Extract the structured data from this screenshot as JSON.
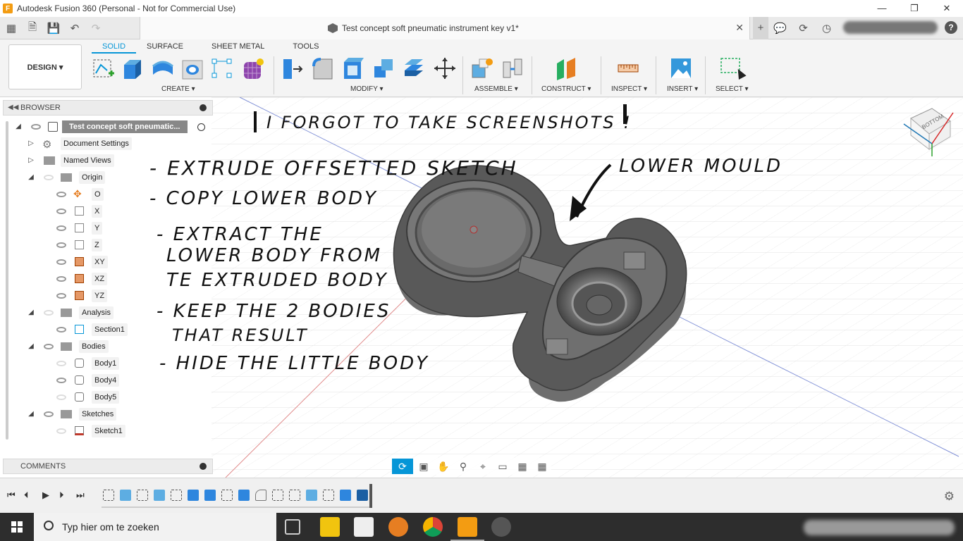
{
  "window": {
    "title": "Autodesk Fusion 360 (Personal - Not for Commercial Use)",
    "minimize": "—",
    "maximize": "❐",
    "close": "✕"
  },
  "document": {
    "title": "Test concept soft pneumatic instrument key v1*",
    "close": "✕"
  },
  "ribbon": {
    "workspace": "DESIGN ▾",
    "tabs": [
      "SOLID",
      "SURFACE",
      "SHEET METAL",
      "TOOLS"
    ],
    "groups": {
      "create": "CREATE ▾",
      "modify": "MODIFY ▾",
      "assemble": "ASSEMBLE ▾",
      "construct": "CONSTRUCT ▾",
      "inspect": "INSPECT ▾",
      "insert": "INSERT ▾",
      "select": "SELECT ▾"
    }
  },
  "browser": {
    "header": "BROWSER",
    "root": "Test concept soft pneumatic...",
    "items": [
      {
        "label": "Document Settings"
      },
      {
        "label": "Named Views"
      },
      {
        "label": "Origin"
      },
      {
        "label": "O"
      },
      {
        "label": "X"
      },
      {
        "label": "Y"
      },
      {
        "label": "Z"
      },
      {
        "label": "XY"
      },
      {
        "label": "XZ"
      },
      {
        "label": "YZ"
      },
      {
        "label": "Analysis"
      },
      {
        "label": "Section1"
      },
      {
        "label": "Bodies"
      },
      {
        "label": "Body1"
      },
      {
        "label": "Body4"
      },
      {
        "label": "Body5"
      },
      {
        "label": "Sketches"
      },
      {
        "label": "Sketch1"
      }
    ]
  },
  "comments": {
    "header": "COMMENTS"
  },
  "annotation": {
    "heading": "I FORGOT TO TAKE SCREENSHOTS !",
    "steps": [
      "- EXTRUDE OFFSETTED SKETCH",
      "- COPY LOWER BODY",
      "- EXTRACT THE",
      "LOWER BODY FROM",
      "TE EXTRUDED BODY",
      "- KEEP THE 2 BODIES",
      "THAT RESULT",
      "- HIDE THE LITTLE BODY"
    ],
    "callout": "LOWER MOULD"
  },
  "viewcube": {
    "face": "BOTTOM"
  },
  "taskbar": {
    "search_placeholder": "Typ hier om te zoeken"
  },
  "colors": {
    "accent": "#0696d7",
    "model": "#5a5a5a",
    "taskbar": "#2d2d2d"
  }
}
